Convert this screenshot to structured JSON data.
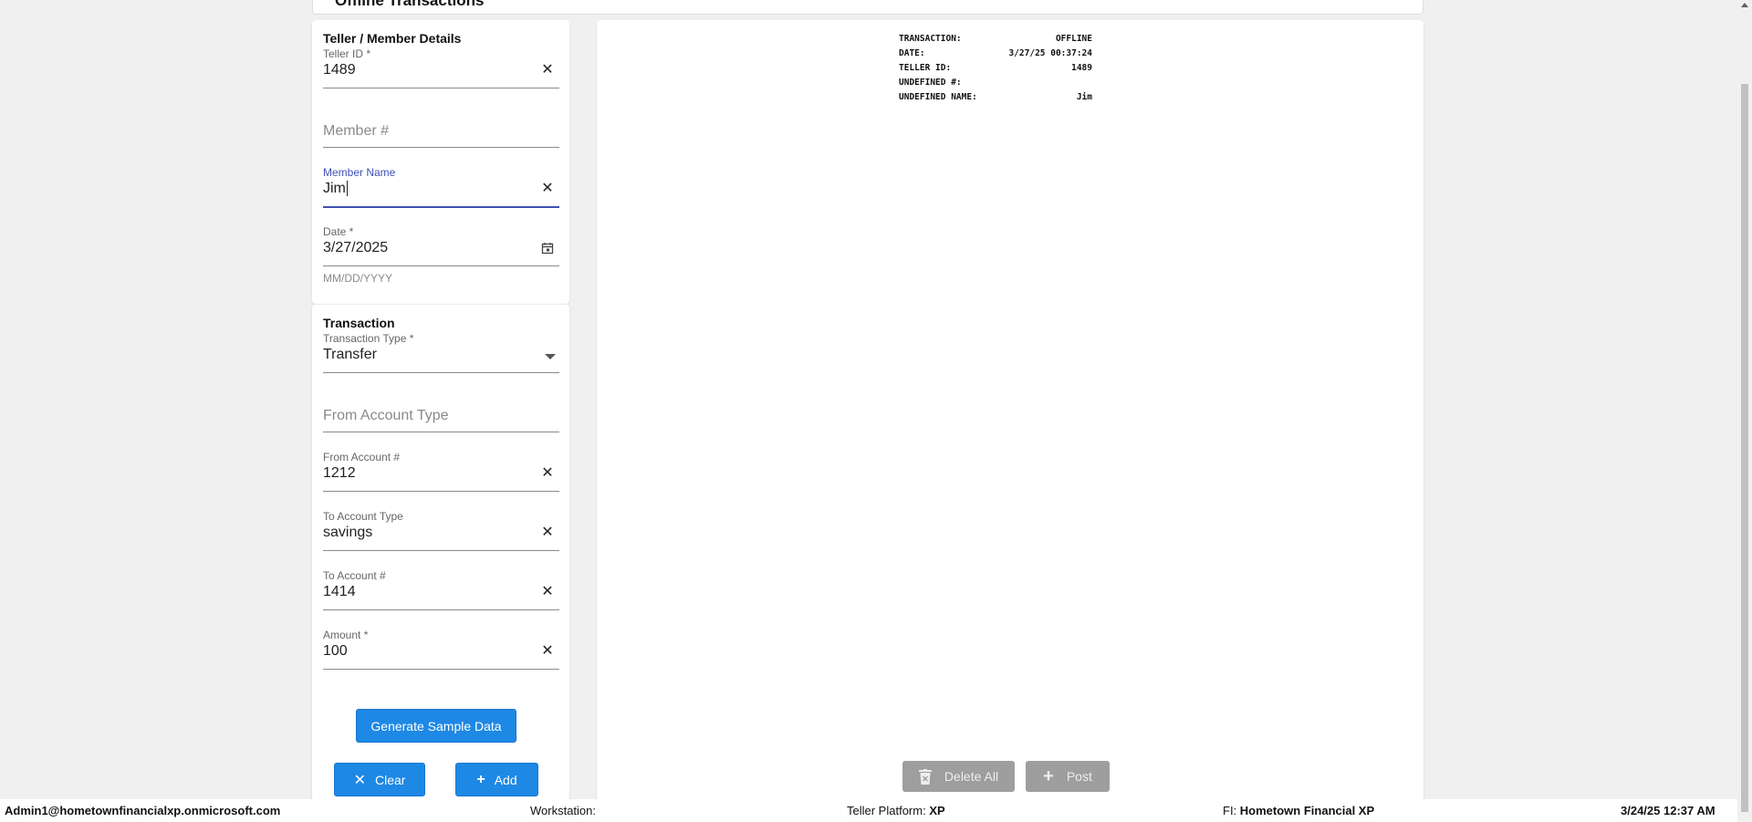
{
  "header": {
    "title": "Offline Transactions"
  },
  "details": {
    "title": "Teller / Member Details",
    "teller_id": {
      "label": "Teller ID *",
      "value": "1489"
    },
    "member_number": {
      "placeholder": "Member #"
    },
    "member_name": {
      "label": "Member Name",
      "value": "Jim"
    },
    "date": {
      "label": "Date *",
      "value": "3/27/2025",
      "helper": "MM/DD/YYYY"
    }
  },
  "transaction": {
    "title": "Transaction",
    "type": {
      "label": "Transaction Type *",
      "value": "Transfer"
    },
    "from_account_type": {
      "placeholder": "From Account Type"
    },
    "from_account": {
      "label": "From Account #",
      "value": "1212"
    },
    "to_account_type": {
      "label": "To Account Type",
      "value": "savings"
    },
    "to_account": {
      "label": "To Account #",
      "value": "1414"
    },
    "amount": {
      "label": "Amount *",
      "value": "100"
    }
  },
  "buttons": {
    "generate": "Generate Sample Data",
    "clear": "Clear",
    "add": "Add",
    "delete_all": "Delete All",
    "post": "Post"
  },
  "receipt": {
    "rows": [
      {
        "label": "TRANSACTION:",
        "value": "OFFLINE"
      },
      {
        "label": "DATE:",
        "value": "3/27/25 00:37:24"
      },
      {
        "label": "TELLER ID:",
        "value": "1489"
      },
      {
        "label": "UNDEFINED #:",
        "value": ""
      },
      {
        "label": "UNDEFINED NAME:",
        "value": "Jim"
      }
    ]
  },
  "status": {
    "user": "Admin1@hometownfinancialxp.onmicrosoft.com",
    "workstation_label": "Workstation:",
    "workstation_value": "",
    "platform_label": "Teller Platform:",
    "platform_value": "XP",
    "fi_label": "FI:",
    "fi_value": "Hometown Financial XP",
    "datetime": "3/24/25 12:37 AM"
  },
  "colors": {
    "primary": "#1e88e5",
    "focus": "#3f51b5",
    "disabled": "#9e9e9e"
  }
}
